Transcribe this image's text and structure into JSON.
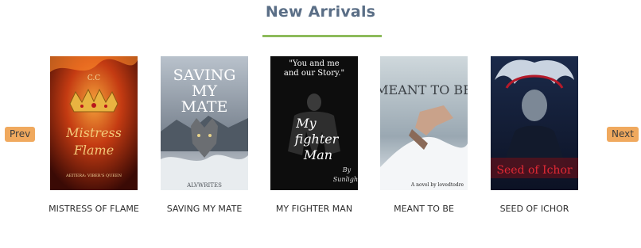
{
  "section": {
    "title": "New Arrivals"
  },
  "nav": {
    "prev_label": "Prev",
    "next_label": "Next"
  },
  "colors": {
    "title": "#5a6e86",
    "underline": "#8dbb5b",
    "nav_button": "#f0a95e"
  },
  "books": [
    {
      "title": "MISTRESS OF FLAME",
      "cover_text": [
        "C.C",
        "Mistress",
        "Flame",
        "AEITERA: VIBER'S QUEEN"
      ]
    },
    {
      "title": "SAVING MY MATE",
      "cover_text": [
        "SAVING",
        "MY",
        "MATE",
        "ALVWRITES"
      ]
    },
    {
      "title": "MY FIGHTER MAN",
      "cover_text": [
        "\"You and me",
        "and our Story.\"",
        "My",
        "fighter",
        "Man",
        "By",
        "Sunlight"
      ]
    },
    {
      "title": "MEANT TO BE",
      "cover_text": [
        "MEANT TO BE",
        "A novel by lovedtodre"
      ]
    },
    {
      "title": "SEED OF ICHOR",
      "cover_text": [
        "Seed of Ichor"
      ]
    }
  ]
}
